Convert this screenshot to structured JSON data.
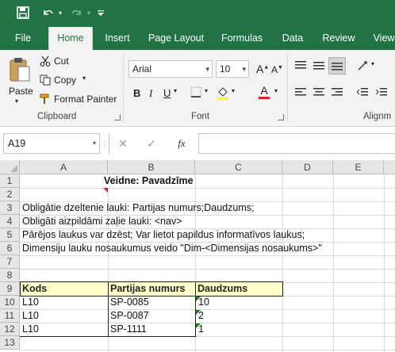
{
  "colors": {
    "brand": "#217346",
    "header_fill": "#ffffcc",
    "comment_marker": "#e3201b",
    "error_marker": "#1e7b1e"
  },
  "qat": {
    "save_icon": "save-icon",
    "undo_icon": "undo-icon",
    "redo_icon": "redo-icon",
    "customize_icon": "customize-icon"
  },
  "tabs": [
    {
      "label": "File"
    },
    {
      "label": "Home",
      "active": true
    },
    {
      "label": "Insert"
    },
    {
      "label": "Page Layout"
    },
    {
      "label": "Formulas"
    },
    {
      "label": "Data"
    },
    {
      "label": "Review"
    },
    {
      "label": "View"
    }
  ],
  "ribbon": {
    "clipboard": {
      "paste_label": "Paste",
      "cut_label": "Cut",
      "copy_label": "Copy",
      "format_painter_label": "Format Painter",
      "group_label": "Clipboard"
    },
    "font": {
      "font_name": "Arial",
      "font_size": "10",
      "bold": "B",
      "italic": "I",
      "underline": "U",
      "font_color_letter": "A",
      "grow_letter": "A",
      "shrink_letter": "A",
      "group_label": "Font"
    },
    "alignment": {
      "group_label": "Alignm"
    }
  },
  "formula_bar": {
    "name_box": "A19",
    "fx_label": "fx",
    "value": ""
  },
  "columns": [
    "A",
    "B",
    "C",
    "D",
    "E"
  ],
  "rows": [
    "1",
    "2",
    "3",
    "4",
    "5",
    "6",
    "7",
    "8",
    "9",
    "10",
    "11",
    "12",
    "13"
  ],
  "cells": {
    "b1": "Veidne: Pavadzīme",
    "a3": "Obligātie dzeltenie lauki: Partijas numurs;Daudzums;",
    "a4": "Obligāti aizpildāmi zaļie lauki: <nav>",
    "a5": "Pārējos laukus var dzēst; Var lietot papildus informatīvos laukus;",
    "a6": "Dimensiju lauku nosaukumus veido \"Dim-<Dimensijas nosaukums>\"",
    "a9": "Kods",
    "b9": "Partijas numurs",
    "c9": "Daudzums",
    "a10": "L10",
    "b10": "SP-0085",
    "c10": "10",
    "a11": "L10",
    "b11": "SP-0087",
    "c11": "2",
    "a12": "L10",
    "b12": "SP-1111",
    "c12": "1"
  }
}
